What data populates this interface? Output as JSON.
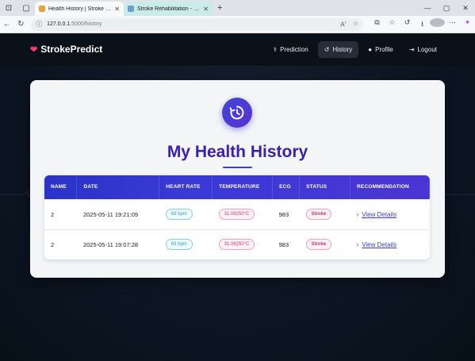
{
  "browser": {
    "tabs": [
      {
        "title": "Health History | Stroke Prediction",
        "active": true,
        "favicon_color": "#e8a23a"
      },
      {
        "title": "Stroke Rehabilitation - ThingSpeak",
        "active": false,
        "favicon_color": "#6aa0d8"
      }
    ],
    "url_host": "127.0.0.1",
    "url_path": ":5000/history"
  },
  "app": {
    "brand": "StrokePredict",
    "nav": [
      {
        "label": "Prediction",
        "icon": "stethoscope-icon",
        "active": false
      },
      {
        "label": "History",
        "icon": "history-icon",
        "active": true
      },
      {
        "label": "Profile",
        "icon": "user-icon",
        "active": false
      },
      {
        "label": "Logout",
        "icon": "logout-icon",
        "active": false
      }
    ],
    "page_title": "My Health History",
    "table": {
      "headers": [
        "NAME",
        "DATE",
        "HEART RATE",
        "TEMPERATURE",
        "ECG",
        "STATUS",
        "RECOMMENDATION"
      ],
      "rows": [
        {
          "name": "2",
          "date": "2025-05-11 19:21:09",
          "heart_rate": "69 bpm",
          "temperature": "31.06250°C",
          "ecg": "983",
          "status": "Stroke",
          "recommendation": "View Details"
        },
        {
          "name": "2",
          "date": "2025-05-11 19:07:28",
          "heart_rate": "69 bpm",
          "temperature": "31.06250°C",
          "ecg": "983",
          "status": "Stroke",
          "recommendation": "View Details"
        }
      ]
    }
  },
  "colors": {
    "accent": "#3a1fb0",
    "header_gradient_start": "#2a33c8",
    "header_gradient_end": "#4b34d4",
    "alert": "#d8366a",
    "heart_rate": "#34a6c8"
  }
}
